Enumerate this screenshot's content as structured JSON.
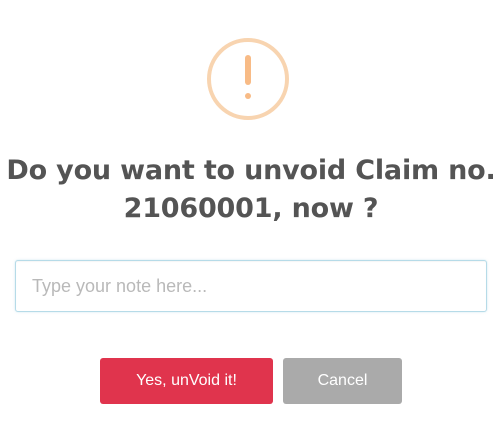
{
  "dialog": {
    "icon": "warning-exclamation-icon",
    "title": "Do you want to unvoid Claim no. 21060001, now ?",
    "note_input": {
      "value": "",
      "placeholder": "Type your note here..."
    },
    "confirm_label": "Yes, unVoid it!",
    "cancel_label": "Cancel"
  },
  "colors": {
    "warning": "#f8bb86",
    "confirm_button": "#e0344d",
    "cancel_button": "#aaaaaa",
    "title_text": "#545454"
  }
}
